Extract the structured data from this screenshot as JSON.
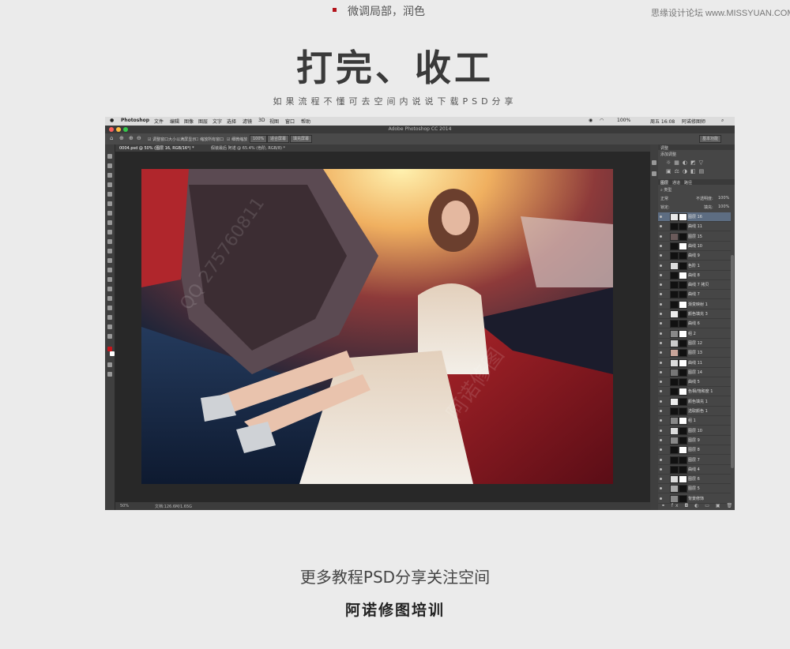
{
  "header": {
    "step_label": "微调局部，润色",
    "site_watermark": "思缘设计论坛 www.MISSYUAN.COM",
    "title": "打完、收工",
    "subtitle": "如果流程不懂可去空间内说说下载PSD分享"
  },
  "photoshop": {
    "mac_menu": {
      "app_name": "Photoshop",
      "items": [
        "文件",
        "编辑",
        "图像",
        "图层",
        "文字",
        "选择",
        "滤镜",
        "3D",
        "视图",
        "窗口",
        "帮助"
      ],
      "battery": "100%",
      "clock": "周五 16:08",
      "user": "阿诺修图师"
    },
    "window_title": "Adobe Photoshop CC 2014",
    "options_bar": {
      "checkbox_1": "调整窗口大小以满屏显示",
      "checkbox_2": "缩放所有窗口",
      "checkbox_3": "细微缩放",
      "zoom_button": "100%",
      "fit_button": "适合屏幕",
      "fill_button": "填充屏幕",
      "workspace": "基本功能"
    },
    "document_tabs": [
      "0004.psd @ 50% (图层 16, RGB/16*) *",
      "假装最后 阿诺 @ 65.4% (色阶, RGB/8) *"
    ],
    "status": {
      "zoom": "50%",
      "doc_size": "文档:126.6M/1.65G"
    },
    "panels": {
      "adjustments_tab": "调整",
      "adjustments_title": "添加调整",
      "layer_tabs": [
        "图层",
        "通道",
        "路径"
      ],
      "kind_filter": "类型",
      "blend_mode": "正常",
      "opacity_label": "不透明度:",
      "opacity_value": "100%",
      "lock_label": "锁定:",
      "fill_label": "填充:",
      "fill_value": "100%",
      "layers": [
        {
          "name": "图层 16",
          "selected": true
        },
        {
          "name": "曲线 11"
        },
        {
          "name": "图层 15"
        },
        {
          "name": "曲线 10"
        },
        {
          "name": "曲线 9"
        },
        {
          "name": "色阶 1"
        },
        {
          "name": "曲线 8"
        },
        {
          "name": "曲线 7 拷贝"
        },
        {
          "name": "曲线 7"
        },
        {
          "name": "渐变映射 1"
        },
        {
          "name": "颜色填充 3"
        },
        {
          "name": "曲线 6"
        },
        {
          "name": "组 2"
        },
        {
          "name": "图层 12"
        },
        {
          "name": "图层 13"
        },
        {
          "name": "曲线 11"
        },
        {
          "name": "图层 14"
        },
        {
          "name": "曲线 5"
        },
        {
          "name": "色相/饱和度 1"
        },
        {
          "name": "颜色填充 1"
        },
        {
          "name": "选取颜色 1"
        },
        {
          "name": "组 1"
        },
        {
          "name": "图层 10"
        },
        {
          "name": "图层 9"
        },
        {
          "name": "图层 8"
        },
        {
          "name": "图层 7"
        },
        {
          "name": "曲线 4"
        },
        {
          "name": "图层 6"
        },
        {
          "name": "图层 5"
        },
        {
          "name": "背景修饰"
        }
      ]
    },
    "canvas_watermarks": [
      "QQ 275760811",
      "阿诺修图"
    ]
  },
  "footer": {
    "line_1": "更多教程PSD分享关注空间",
    "line_2": "阿诺修图培训"
  }
}
